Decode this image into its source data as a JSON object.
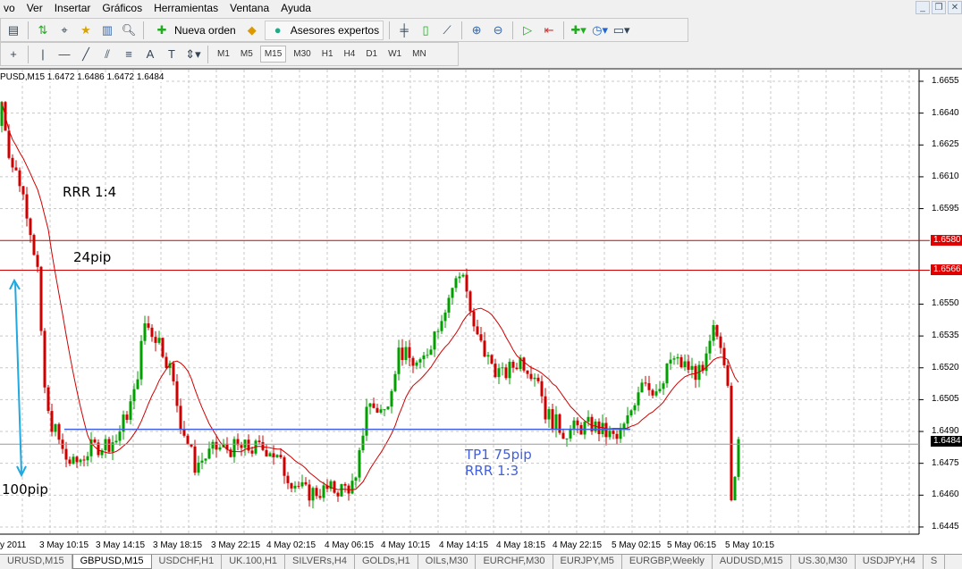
{
  "menu": [
    "vo",
    "Ver",
    "Insertar",
    "Gráficos",
    "Herramientas",
    "Ventana",
    "Ayuda"
  ],
  "toolbar": {
    "new_order": "Nueva orden",
    "experts": "Asesores expertos",
    "timeframes": [
      "M1",
      "M5",
      "M15",
      "M30",
      "H1",
      "H4",
      "D1",
      "W1",
      "MN"
    ],
    "active_timeframe": "M15",
    "text_tool": "A"
  },
  "chart": {
    "info": "PUSD,M15  1.6472 1.6486 1.6472 1.6484",
    "price_labels": [
      "1.6655",
      "1.6640",
      "1.6625",
      "1.6610",
      "1.6595",
      "1.6550",
      "1.6535",
      "1.6520",
      "1.6505",
      "1.6490",
      "1.6475",
      "1.6460",
      "1.6445"
    ],
    "time_labels": [
      "y 2011",
      "3 May 10:15",
      "3 May 14:15",
      "3 May 18:15",
      "3 May 22:15",
      "4 May 02:15",
      "4 May 06:15",
      "4 May 10:15",
      "4 May 14:15",
      "4 May 18:15",
      "4 May 22:15",
      "5 May 02:15",
      "5 May 06:15",
      "5 May 10:15"
    ],
    "annotations": {
      "rrr14": "RRR 1:4",
      "pip24": "24pip",
      "pip100": "100pip",
      "tp1": "TP1 75pip",
      "rrr13": "RRR 1:3"
    },
    "levels": {
      "red1": "1.6580",
      "red2": "1.6566",
      "current": "1.6484",
      "tp": 1.6491
    },
    "colors": {
      "bull": "#00a000",
      "bear": "#d00000",
      "ma": "#d00000",
      "level": "#d00000",
      "tp": "#4060e0",
      "arrow": "#20a8e0"
    }
  },
  "chart_data": {
    "type": "candlestick",
    "symbol": "GBPUSD",
    "timeframe": "M15",
    "ylim": [
      1.644,
      1.6662
    ],
    "path": [
      [
        1,
        1.6634
      ],
      [
        2.5,
        1.6617
      ],
      [
        5,
        1.6608
      ],
      [
        7.5,
        1.6591
      ],
      [
        10,
        1.6566
      ],
      [
        11,
        1.6533
      ],
      [
        12.5,
        1.6499
      ],
      [
        15,
        1.649
      ],
      [
        17.5,
        1.6478
      ],
      [
        20,
        1.6474
      ],
      [
        25,
        1.6482
      ],
      [
        32,
        1.6486
      ],
      [
        37,
        1.6507
      ],
      [
        40,
        1.6541
      ],
      [
        44,
        1.6533
      ],
      [
        47,
        1.652
      ],
      [
        50,
        1.6495
      ],
      [
        54,
        1.6474
      ],
      [
        60,
        1.6482
      ],
      [
        67,
        1.6482
      ],
      [
        75,
        1.6482
      ],
      [
        80,
        1.6469
      ],
      [
        85,
        1.6461
      ],
      [
        95,
        1.6463
      ],
      [
        99,
        1.6465
      ],
      [
        102,
        1.6503
      ],
      [
        107,
        1.6499
      ],
      [
        111,
        1.6528
      ],
      [
        117,
        1.652
      ],
      [
        122,
        1.6541
      ],
      [
        126,
        1.6558
      ],
      [
        129,
        1.6566
      ],
      [
        132,
        1.6537
      ],
      [
        136,
        1.6524
      ],
      [
        140,
        1.6516
      ],
      [
        145,
        1.6524
      ],
      [
        150,
        1.6516
      ],
      [
        152,
        1.6499
      ],
      [
        157,
        1.649
      ],
      [
        165,
        1.6493
      ],
      [
        172,
        1.6486
      ],
      [
        175,
        1.6495
      ],
      [
        179,
        1.6516
      ],
      [
        184,
        1.6507
      ],
      [
        187,
        1.6524
      ],
      [
        192,
        1.652
      ],
      [
        196,
        1.6516
      ],
      [
        199,
        1.6537
      ],
      [
        201,
        1.6533
      ],
      [
        203,
        1.6516
      ],
      [
        204,
        1.6461
      ],
      [
        205,
        1.6465
      ],
      [
        206,
        1.6484
      ]
    ],
    "ma_period": 14
  },
  "tabs": [
    "URUSD,M15",
    "GBPUSD,M15",
    "USDCHF,H1",
    "UK.100,H1",
    "SILVERs,H4",
    "GOLDs,H1",
    "OILs,M30",
    "EURCHF,M30",
    "EURJPY,M5",
    "EURGBP,Weekly",
    "AUDUSD,M15",
    "US.30,M30",
    "USDJPY,H4",
    "S"
  ],
  "active_tab": "GBPUSD,M15"
}
